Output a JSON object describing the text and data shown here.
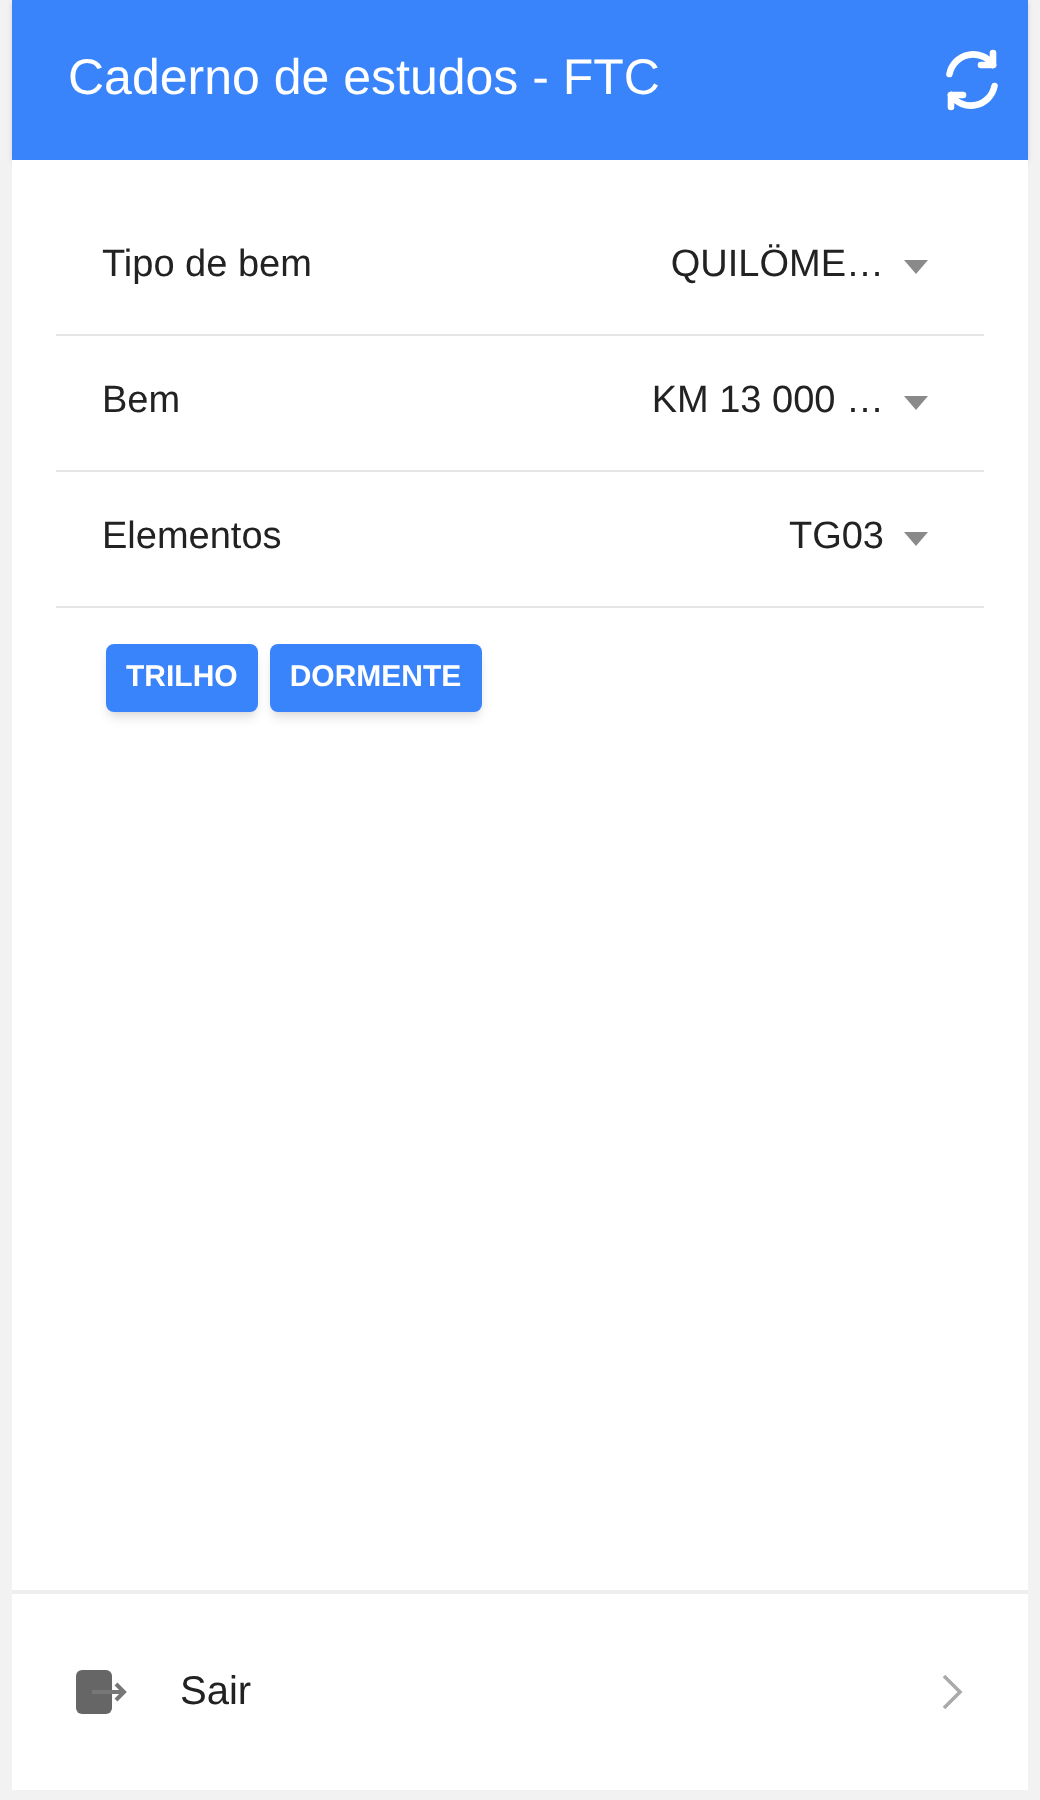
{
  "header": {
    "title": "Caderno de estudos - FTC"
  },
  "fields": [
    {
      "label": "Tipo de bem",
      "value": "QUILÖME…"
    },
    {
      "label": "Bem",
      "value": "KM 13 000 …"
    },
    {
      "label": "Elementos",
      "value": "TG03"
    }
  ],
  "chips": [
    "TRILHO",
    "DORMENTE"
  ],
  "footer": {
    "label": "Sair"
  }
}
